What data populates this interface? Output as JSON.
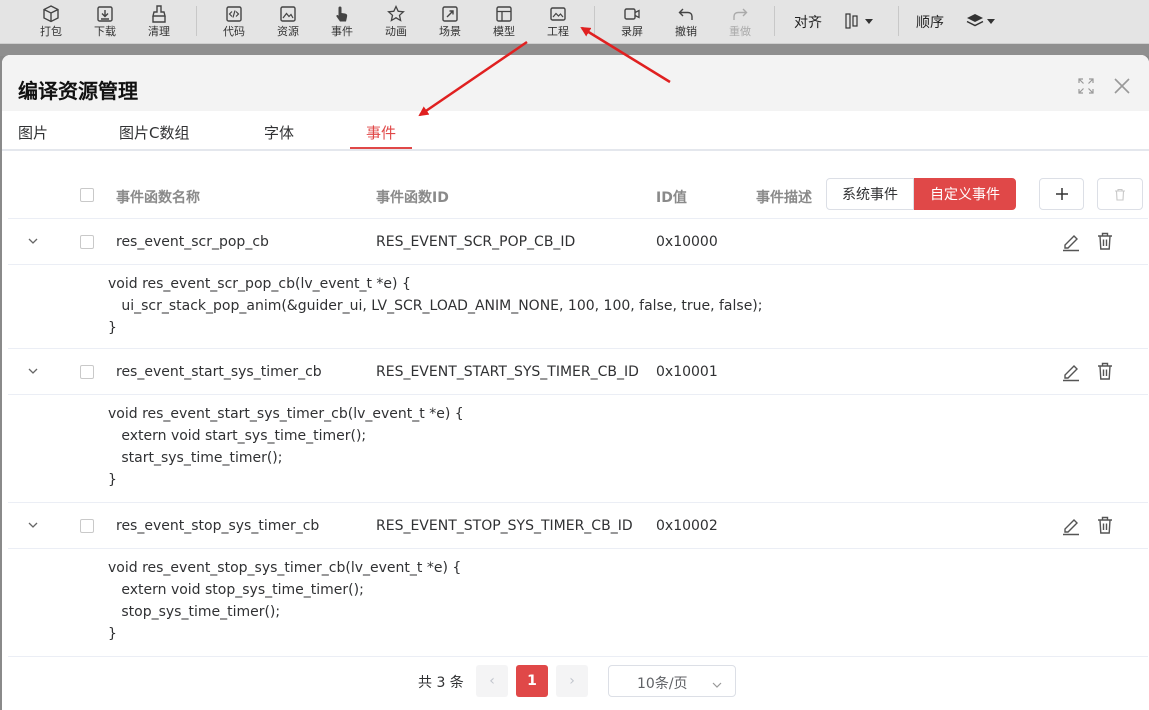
{
  "toolbar": {
    "items": [
      {
        "label": "打包",
        "icon": "package-icon"
      },
      {
        "label": "下载",
        "icon": "download-icon"
      },
      {
        "label": "清理",
        "icon": "broom-icon"
      },
      {
        "label": "代码",
        "icon": "code-icon"
      },
      {
        "label": "资源",
        "icon": "image-icon"
      },
      {
        "label": "事件",
        "icon": "hand-pointer-icon"
      },
      {
        "label": "动画",
        "icon": "star-icon"
      },
      {
        "label": "场景",
        "icon": "scene-icon"
      },
      {
        "label": "模型",
        "icon": "model-icon"
      },
      {
        "label": "工程",
        "icon": "project-icon"
      },
      {
        "label": "录屏",
        "icon": "record-icon"
      },
      {
        "label": "撤销",
        "icon": "undo-icon"
      },
      {
        "label": "重做",
        "icon": "redo-icon"
      }
    ],
    "align_label": "对齐",
    "order_label": "顺序"
  },
  "modal": {
    "title": "编译资源管理",
    "tabs": [
      "图片",
      "图片C数组",
      "字体",
      "事件"
    ],
    "active_tab": "事件"
  },
  "table": {
    "headers": {
      "name": "事件函数名称",
      "id": "事件函数ID",
      "value": "ID值",
      "desc": "事件描述"
    },
    "filter_buttons": [
      "系统事件",
      "自定义事件"
    ],
    "active_filter": "自定义事件",
    "add_label": "+",
    "rows": [
      {
        "name": "res_event_scr_pop_cb",
        "id": "RES_EVENT_SCR_POP_CB_ID",
        "value": "0x10000",
        "code": [
          "void res_event_scr_pop_cb(lv_event_t *e) {",
          "   ui_scr_stack_pop_anim(&guider_ui, LV_SCR_LOAD_ANIM_NONE, 100, 100, false, true, false);",
          "}"
        ]
      },
      {
        "name": "res_event_start_sys_timer_cb",
        "id": "RES_EVENT_START_SYS_TIMER_CB_ID",
        "value": "0x10001",
        "code": [
          "void res_event_start_sys_timer_cb(lv_event_t *e) {",
          "   extern void start_sys_time_timer();",
          "   start_sys_time_timer();",
          "}"
        ]
      },
      {
        "name": "res_event_stop_sys_timer_cb",
        "id": "RES_EVENT_STOP_SYS_TIMER_CB_ID",
        "value": "0x10002",
        "code": [
          "void res_event_stop_sys_timer_cb(lv_event_t *e) {",
          "   extern void stop_sys_time_timer();",
          "   stop_sys_time_timer();",
          "}"
        ]
      }
    ]
  },
  "pagination": {
    "total": "共 3 条",
    "current_page": "1",
    "prev": "‹",
    "next": "›",
    "page_size": "10条/页"
  },
  "colors": {
    "accent": "#e04848",
    "annotation_arrow": "#e02020"
  }
}
